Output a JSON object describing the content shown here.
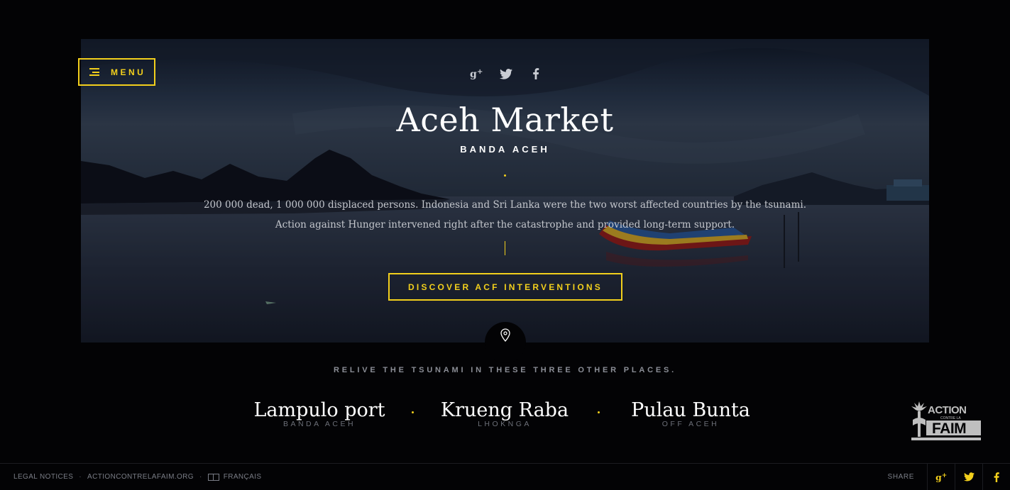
{
  "header": {
    "menu_label": "MENU",
    "social": [
      {
        "icon": "google-plus-icon",
        "glyph": "g+"
      },
      {
        "icon": "twitter-icon",
        "glyph": "t"
      },
      {
        "icon": "facebook-icon",
        "glyph": "f"
      }
    ]
  },
  "hero": {
    "title": "Aceh Market",
    "subtitle": "BANDA ACEH",
    "description_line1": "200 000 dead, 1 000 000 displaced persons. Indonesia and Sri Lanka were the two worst affected countries by the tsunami.",
    "description_line2": "Action against Hunger intervened right after the catastrophe and provided long-term support.",
    "cta_label": "DISCOVER ACF INTERVENTIONS"
  },
  "places_section": {
    "heading": "RELIVE THE TSUNAMI IN THESE THREE OTHER PLACES.",
    "places": [
      {
        "name": "Lampulo port",
        "region": "BANDA ACEH"
      },
      {
        "name": "Krueng Raba",
        "region": "LHOKNGA"
      },
      {
        "name": "Pulau Bunta",
        "region": "OFF ACEH"
      }
    ]
  },
  "logo": {
    "line1": "ACTION",
    "line2": "CONTRE LA",
    "line3": "FAIM"
  },
  "footer": {
    "legal": "LEGAL NOTICES",
    "site": "ACTIONCONTRELAFAIM.ORG",
    "language": "FRANÇAIS",
    "share_label": "SHARE"
  },
  "colors": {
    "accent": "#f2cf1c",
    "background": "#030305"
  }
}
